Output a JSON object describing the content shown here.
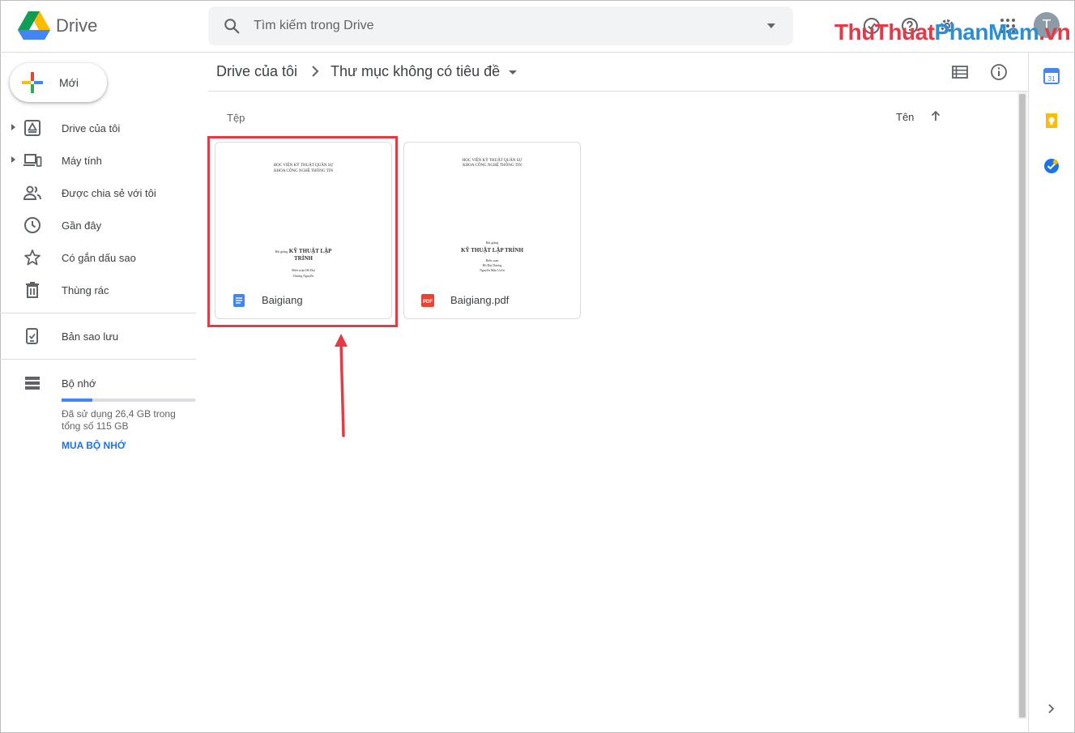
{
  "app": {
    "name": "Drive"
  },
  "watermark": {
    "part1": "ThuThuat",
    "part2": "PhanMem",
    "part3": ".vn"
  },
  "search": {
    "placeholder": "Tìm kiếm trong Drive"
  },
  "header_icons": [
    "offline-status-icon",
    "help-icon",
    "settings-icon",
    "apps-grid-icon"
  ],
  "user": {
    "avatar_letter": "T"
  },
  "sidebar": {
    "new_label": "Mới",
    "items": [
      {
        "label": "Drive của tôi",
        "icon": "my-drive-icon",
        "expandable": true
      },
      {
        "label": "Máy tính",
        "icon": "computers-icon",
        "expandable": true
      },
      {
        "label": "Được chia sẻ với tôi",
        "icon": "shared-icon",
        "expandable": false
      },
      {
        "label": "Gần đây",
        "icon": "clock-icon",
        "expandable": false
      },
      {
        "label": "Có gắn dấu sao",
        "icon": "star-icon",
        "expandable": false
      },
      {
        "label": "Thùng rác",
        "icon": "trash-icon",
        "expandable": false
      }
    ],
    "backup_label": "Bản sao lưu",
    "storage": {
      "label": "Bộ nhớ",
      "used_text": "Đã sử dụng 26,4 GB trong tổng số 115 GB",
      "used_fraction": 0.23,
      "buy_label": "MUA BỘ NHỚ"
    }
  },
  "breadcrumb": {
    "root": "Drive của tôi",
    "current": "Thư mục không có tiêu đề"
  },
  "files_section": {
    "title": "Tệp",
    "sort_label": "Tên",
    "files": [
      {
        "name": "Baigiang",
        "type_icon": "google-docs-icon",
        "preview": {
          "line1": "HỌC VIỆN KỸ THUẬT QUÂN SỰ",
          "line2": "KHOA CÔNG NGHỆ THÔNG TIN",
          "prefix": "Bài giảng",
          "title_a": "KỸ THUẬT LẬP",
          "title_b": "TRÌNH",
          "author_label": "Biên soạn",
          "author1": "Hồ Đại",
          "author2": "Dương Nguyễn"
        },
        "highlighted": true
      },
      {
        "name": "Baigiang.pdf",
        "type_icon": "pdf-icon",
        "type_badge": "PDF",
        "preview": {
          "line1": "HỌC VIỆN KỸ THUẬT QUÂN SỰ",
          "line2": "KHOA CÔNG NGHỆ THÔNG TIN",
          "prefix": "Bài giảng",
          "title_a": "KỸ THUẬT LẬP TRÌNH",
          "author_label": "Biên soạn",
          "author1": "Hồ Đại Dương",
          "author2": "Nguyễn Mậu Uyên"
        },
        "highlighted": false
      }
    ]
  },
  "colors": {
    "accent_blue": "#1a73e8",
    "annotation_red": "#e53945",
    "storage_fill": "#4285f4"
  }
}
